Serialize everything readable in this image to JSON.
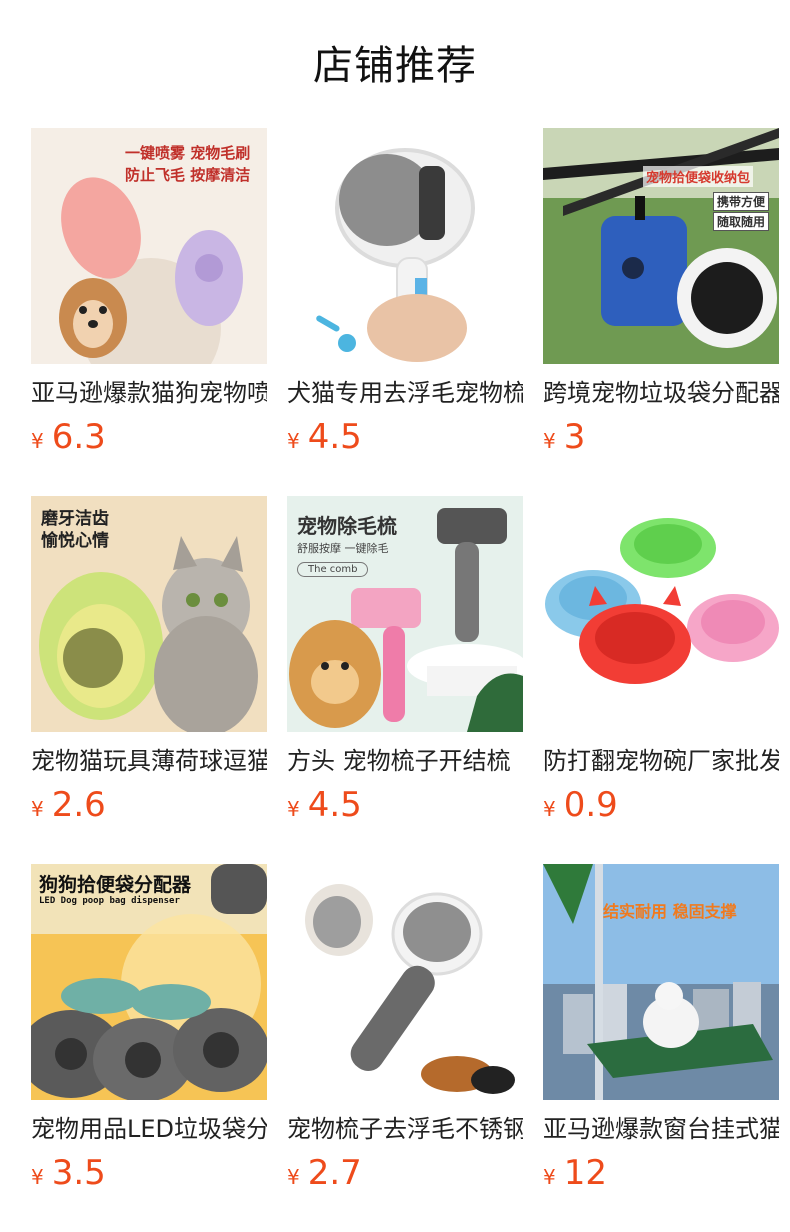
{
  "page": {
    "title": "店铺推荐"
  },
  "currency_symbol": "¥",
  "products": [
    {
      "name": "亚马逊爆款猫狗宠物喷雾按摩梳",
      "price": "6.3",
      "image": "spray-brush-image",
      "overlay": [
        "一键喷雾 宠物毛刷",
        "防止飞毛 按摩清洁"
      ]
    },
    {
      "name": "犬猫专用去浮毛宠物梳",
      "price": "4.5",
      "image": "self-clean-brush-image"
    },
    {
      "name": "跨境宠物垃圾袋分配器",
      "price": "3",
      "image": "poop-bag-holder-image",
      "overlay": [
        "宠物拾便袋收纳包",
        "携带方便",
        "随取随用"
      ]
    },
    {
      "name": "宠物猫玩具薄荷球逗猫",
      "price": "2.6",
      "image": "catnip-ball-image",
      "overlay": [
        "磨牙洁齿",
        "愉悦心情"
      ]
    },
    {
      "name": "方头 宠物梳子开结梳",
      "price": "4.5",
      "image": "slicker-brush-image",
      "overlay": [
        "宠物除毛梳",
        "舒服按摩 一键除毛",
        "The comb"
      ]
    },
    {
      "name": "防打翻宠物碗厂家批发",
      "price": "0.9",
      "image": "pet-bowls-image"
    },
    {
      "name": "宠物用品LED垃圾袋分配器",
      "price": "3.5",
      "image": "led-bag-dispenser-image",
      "overlay": [
        "狗狗拾便袋分配器",
        "LED Dog poop bag dispenser"
      ]
    },
    {
      "name": "宠物梳子去浮毛不锈钢针梳",
      "price": "2.7",
      "image": "grey-brush-image"
    },
    {
      "name": "亚马逊爆款窗台挂式猫吊床",
      "price": "12",
      "image": "window-hammock-image",
      "overlay": [
        "结实耐用 稳固支撑"
      ]
    }
  ]
}
